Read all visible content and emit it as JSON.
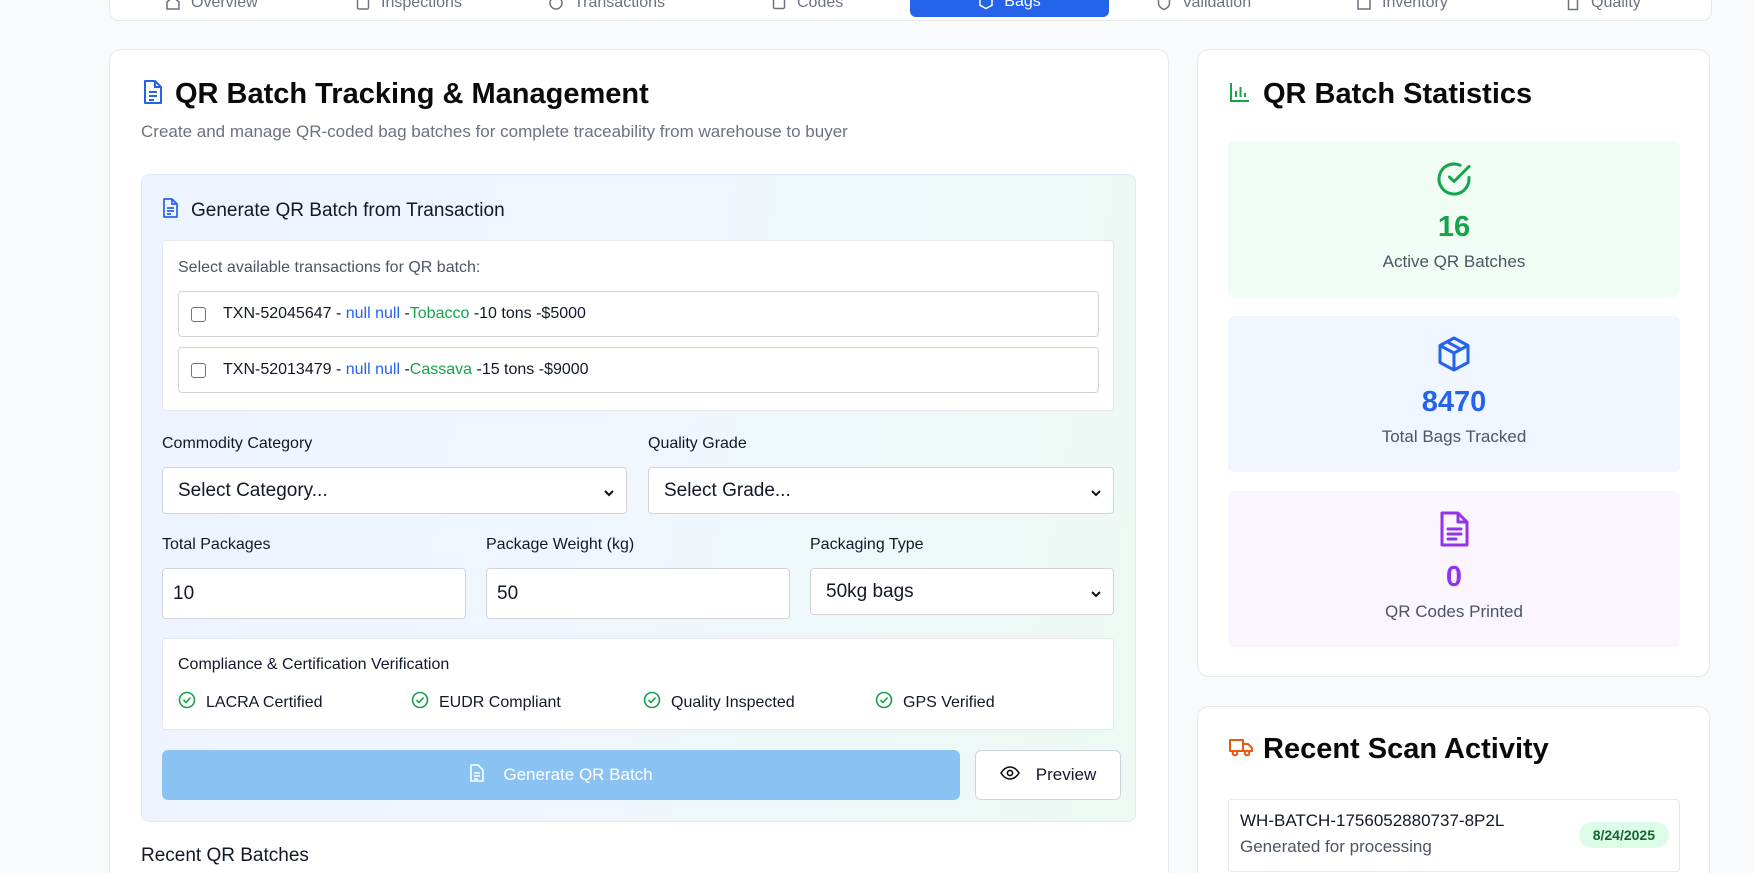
{
  "nav": {
    "tabs": [
      {
        "label": "Overview",
        "icon": "home-icon"
      },
      {
        "label": "Inspections",
        "icon": "clipboard-icon"
      },
      {
        "label": "Transactions",
        "icon": "clock-icon"
      },
      {
        "label": "Codes",
        "icon": "qr-icon"
      },
      {
        "label": "Bags",
        "icon": "package-icon",
        "active": true
      },
      {
        "label": "Validation",
        "icon": "shield-icon"
      },
      {
        "label": "Inventory",
        "icon": "warehouse-icon"
      },
      {
        "label": "Quality",
        "icon": "file-icon"
      }
    ]
  },
  "main": {
    "title": "QR Batch Tracking & Management",
    "subtitle": "Create and manage QR-coded bag batches for complete traceability from warehouse to buyer",
    "generate": {
      "title": "Generate QR Batch from Transaction",
      "tx_label": "Select available transactions for QR batch:",
      "transactions": [
        {
          "id": "TXN-52045647",
          "party": "null null",
          "commodity": "Tobacco",
          "qty": "10 tons",
          "price": "$5000"
        },
        {
          "id": "TXN-52013479",
          "party": "null null",
          "commodity": "Cassava",
          "qty": "15 tons",
          "price": "$9000"
        }
      ],
      "commodity_label": "Commodity Category",
      "commodity_value": "Select Category...",
      "grade_label": "Quality Grade",
      "grade_value": "Select Grade...",
      "packages_label": "Total Packages",
      "packages_value": "10",
      "weight_label": "Package Weight (kg)",
      "weight_value": "50",
      "packaging_label": "Packaging Type",
      "packaging_value": "50kg bags",
      "compliance_title": "Compliance & Certification Verification",
      "compliance": [
        "LACRA Certified",
        "EUDR Compliant",
        "Quality Inspected",
        "GPS Verified"
      ],
      "generate_button": "Generate QR Batch",
      "preview_button": "Preview"
    },
    "recent_title": "Recent QR Batches"
  },
  "stats": {
    "title": "QR Batch Statistics",
    "items": [
      {
        "value": "16",
        "label": "Active QR Batches",
        "color": "#16a34a",
        "bg": "#f0fdf4",
        "icon": "check-circle-icon"
      },
      {
        "value": "8470",
        "label": "Total Bags Tracked",
        "color": "#2563eb",
        "bg": "#eff6ff",
        "icon": "package-icon"
      },
      {
        "value": "0",
        "label": "QR Codes Printed",
        "color": "#9333ea",
        "bg": "#faf5ff",
        "icon": "file-text-icon"
      }
    ]
  },
  "scan": {
    "title": "Recent Scan Activity",
    "items": [
      {
        "id": "WH-BATCH-1756052880737-8P2L",
        "desc": "Generated for processing",
        "date": "8/24/2025"
      }
    ]
  }
}
